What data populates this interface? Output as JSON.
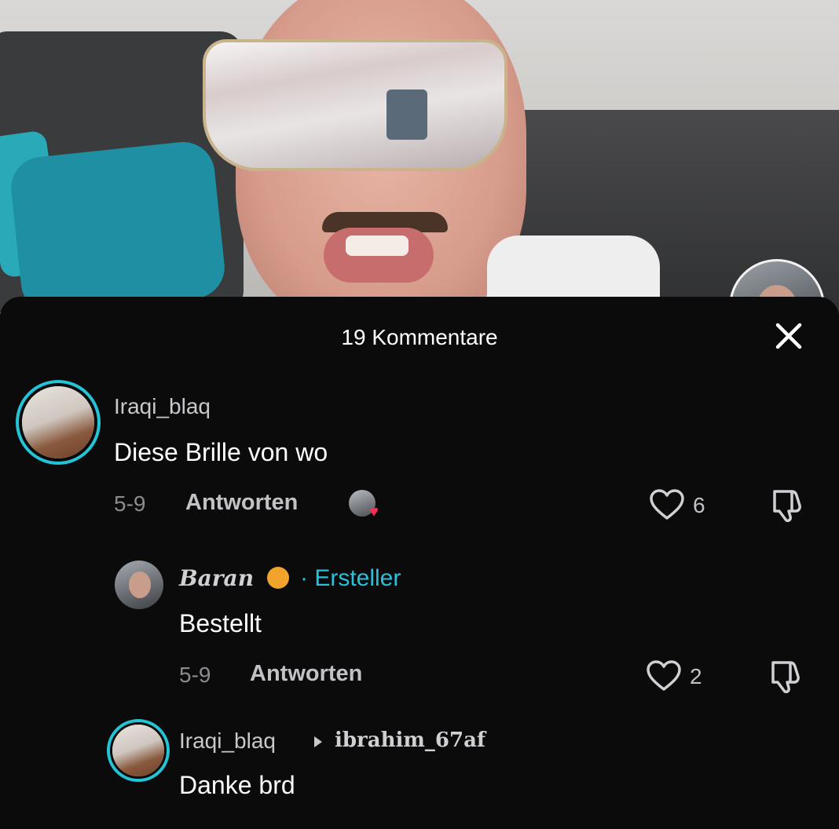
{
  "sheet": {
    "title": "19 Kommentare"
  },
  "comments": [
    {
      "username": "Iraqi_blaq",
      "text": "Diese Brille von wo",
      "date": "5-9",
      "reply_label": "Antworten",
      "likes": "6"
    },
    {
      "username": "Baran",
      "creator_tag": "· Ersteller",
      "text": "Bestellt",
      "date": "5-9",
      "reply_label": "Antworten",
      "likes": "2"
    },
    {
      "username": "Iraqi_blaq",
      "reply_to": "ibrahim_67af",
      "text": "Danke brd"
    }
  ],
  "colors": {
    "accent": "#25c3d6",
    "heart_liked": "#ff2d55",
    "sheet_bg": "#0b0b0c"
  }
}
